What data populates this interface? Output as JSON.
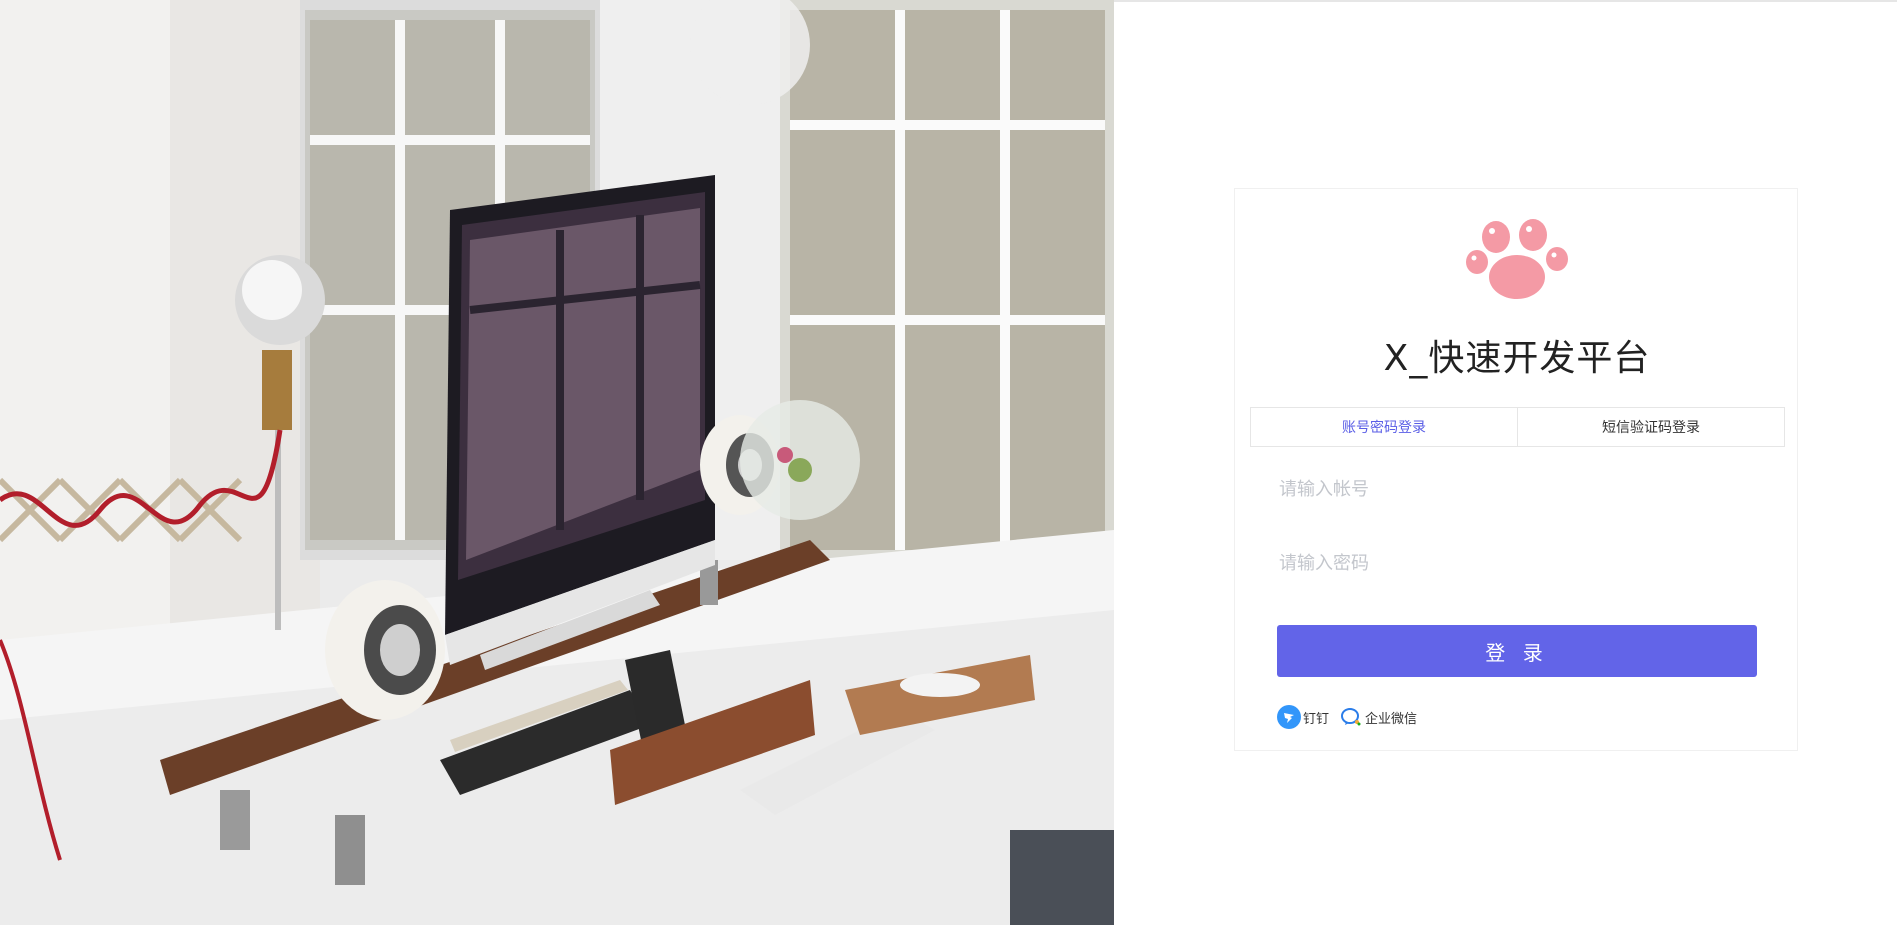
{
  "brand": {
    "logo_icon": "paw-icon",
    "logo_color": "#f49aa5",
    "title": "X_快速开发平台"
  },
  "tabs": [
    {
      "label": "账号密码登录",
      "active": true
    },
    {
      "label": "短信验证码登录",
      "active": false
    }
  ],
  "form": {
    "username_placeholder": "请输入帐号",
    "password_placeholder": "请输入密码",
    "submit_label": "登 录",
    "accent": "#6264e8"
  },
  "social": [
    {
      "label": "钉钉",
      "icon": "dingtalk-icon"
    },
    {
      "label": "企业微信",
      "icon": "wecom-icon"
    }
  ],
  "illustration": {
    "icon": "desk-photo"
  }
}
